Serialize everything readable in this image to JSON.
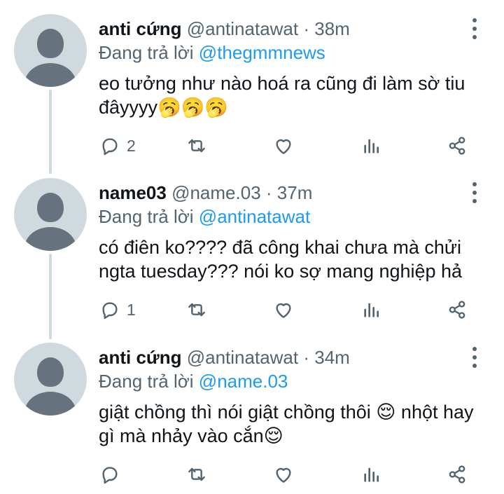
{
  "tweets": [
    {
      "name": "anti cứng",
      "handle": "@antinatawat",
      "time": "38m",
      "reply_prefix": "Đang trả lời",
      "reply_to": "@thegmmnews",
      "text": "eo tưởng như nào hoá ra cũng đi làm sờ tiu đâyyyy🥱🥱🥱",
      "reply_count": "2"
    },
    {
      "name": "name03",
      "handle": "@name.03",
      "time": "37m",
      "reply_prefix": "Đang trả lời",
      "reply_to": "@antinatawat",
      "text": "có điên ko???? đã công khai chưa mà chửi ngta tuesday??? nói ko sợ mang nghiệp hả",
      "reply_count": "1"
    },
    {
      "name": "anti cứng",
      "handle": "@antinatawat",
      "time": "34m",
      "reply_prefix": "Đang trả lời",
      "reply_to": "@name.03",
      "text": "giật chồng thì nói giật chồng thôi 😌 nhột hay gì mà nhảy vào cắn😌",
      "reply_count": ""
    }
  ],
  "separator": "·",
  "icons": {
    "reply": "reply-icon",
    "retweet": "retweet-icon",
    "like": "like-icon",
    "views": "views-icon",
    "share": "share-icon",
    "more": "more-vertical-icon"
  },
  "colors": {
    "text": "#0f1419",
    "secondary": "#536471",
    "link": "#1d9bf0",
    "avatar_bg": "#cfd9de",
    "avatar_fg": "#66737f"
  }
}
